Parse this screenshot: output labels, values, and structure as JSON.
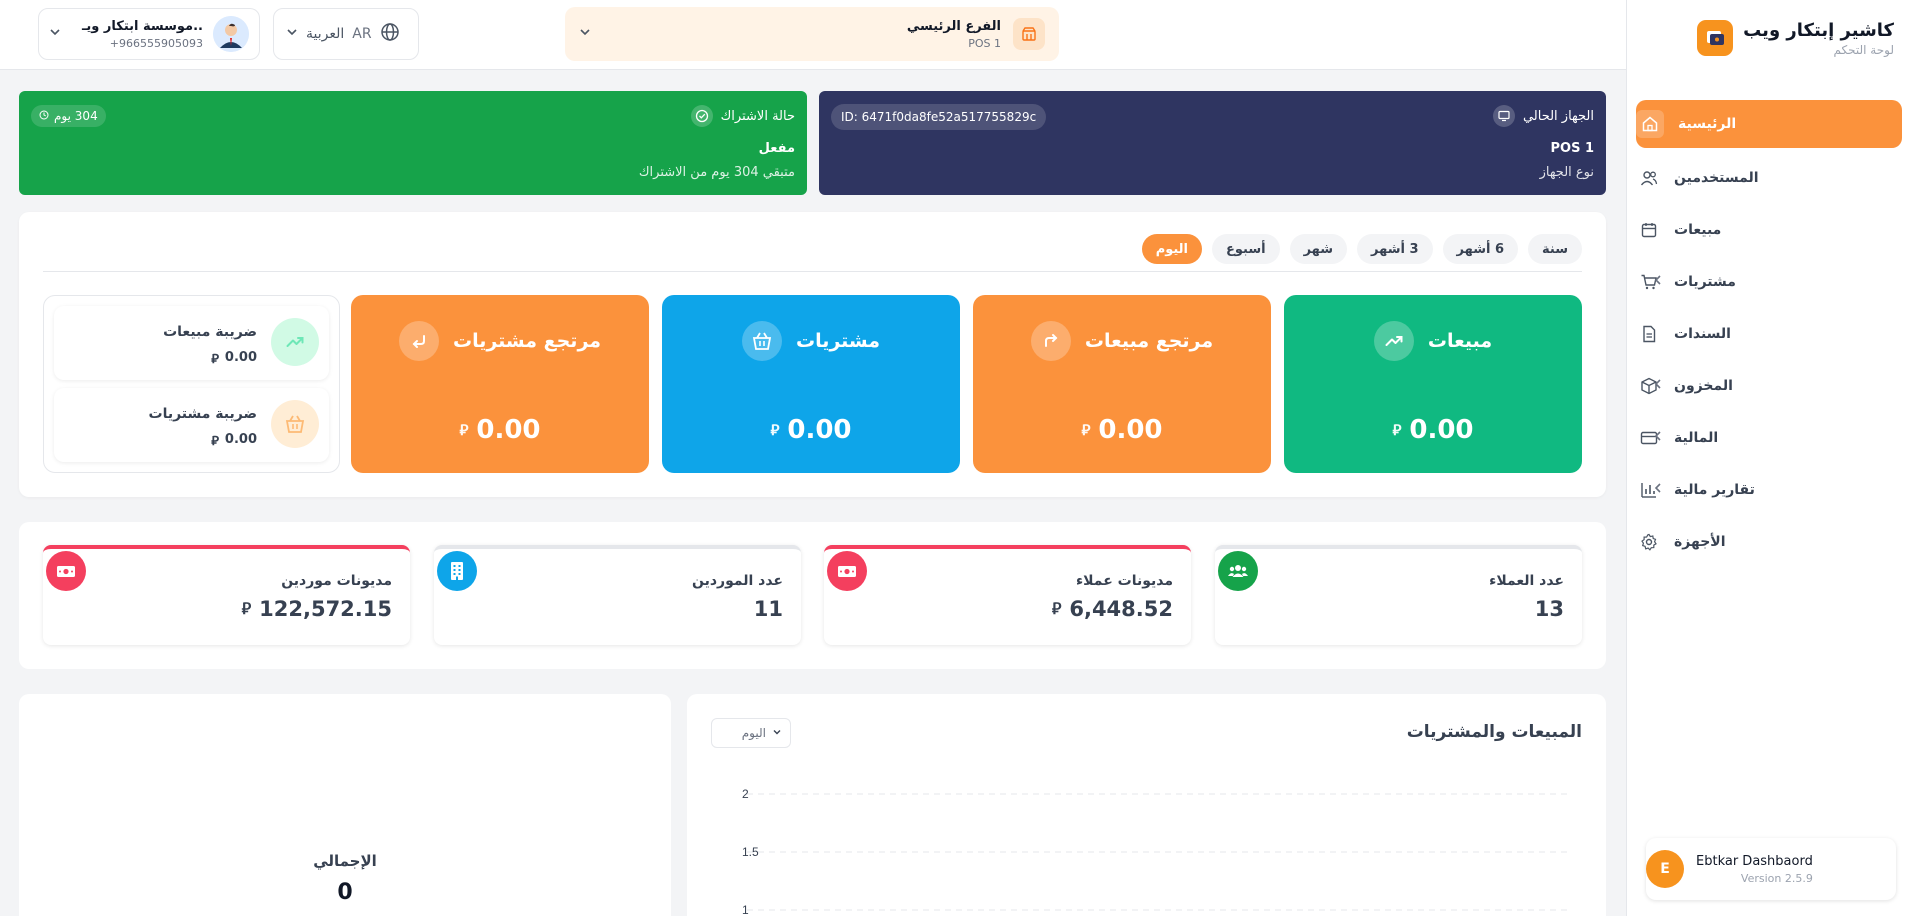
{
  "brand": {
    "title": "كاشير إبتكار ويب",
    "subtitle": "لوحة التحكم"
  },
  "sidebar": {
    "items": [
      {
        "label": "الرئيسية",
        "icon": "home-icon",
        "active": true,
        "expandable": false
      },
      {
        "label": "المستخدمين",
        "icon": "users-icon",
        "active": false,
        "expandable": false
      },
      {
        "label": "مبيعات",
        "icon": "calendar-icon",
        "active": false,
        "expandable": false
      },
      {
        "label": "مشتريات",
        "icon": "cart-icon",
        "active": false,
        "expandable": true
      },
      {
        "label": "السندات",
        "icon": "document-icon",
        "active": false,
        "expandable": false
      },
      {
        "label": "المخزون",
        "icon": "box-icon",
        "active": false,
        "expandable": true
      },
      {
        "label": "المالية",
        "icon": "card-icon",
        "active": false,
        "expandable": true
      },
      {
        "label": "تقارير مالية",
        "icon": "bar-chart-icon",
        "active": false,
        "expandable": true
      },
      {
        "label": "الأجهزة",
        "icon": "gear-icon",
        "active": false,
        "expandable": false
      }
    ],
    "version_card": {
      "avatar_letter": "E",
      "name": "Ebtkar Dashbaord",
      "version": "Version 2.5.9"
    }
  },
  "header": {
    "user": {
      "name": "موسسة ابتكار ويـ..",
      "phone": "+966555905093"
    },
    "language": {
      "label": "العربية",
      "code": "AR"
    },
    "branch": {
      "name": "الفرع الرئيسي",
      "pos": "POS 1"
    }
  },
  "device_card": {
    "title": "الجهاز الحالي",
    "device_id": "ID: 6471f0da8fe52a517755829c",
    "pos": "POS 1",
    "type_label": "نوع الجهاز",
    "color": "#2f3561"
  },
  "subscription_card": {
    "title": "حالة الاشتراك",
    "status": "مفعل",
    "remaining": "متبقي 304 يوم من الاشتراك",
    "days_pill": "304 يوم",
    "color": "#16a34a"
  },
  "periods": [
    "اليوم",
    "أسبوع",
    "شهر",
    "3 أشهر",
    "6 أشهر",
    "سنة"
  ],
  "active_period": "اليوم",
  "stat_cards": [
    {
      "label": "مبيعات",
      "value": "0.00",
      "color": "#10b981",
      "icon": "trend-up-icon"
    },
    {
      "label": "مرتجع مبيعات",
      "value": "0.00",
      "color": "#fb923c",
      "icon": "return-right-icon"
    },
    {
      "label": "مشتريات",
      "value": "0.00",
      "color": "#0ea5e9",
      "icon": "basket-icon"
    },
    {
      "label": "مرتجع مشتريات",
      "value": "0.00",
      "color": "#fb923c",
      "icon": "return-left-icon"
    }
  ],
  "taxes": [
    {
      "label": "ضريبة مبيعات",
      "value": "0.00",
      "icon": "trend-up-icon",
      "color": "#d1fae5"
    },
    {
      "label": "ضريبة مشتريات",
      "value": "0.00",
      "icon": "basket-icon",
      "color": "#ffedd5"
    }
  ],
  "currency_symbol": "⃁",
  "counts": [
    {
      "label": "عدد العملاء",
      "value": "13",
      "icon": "people-icon",
      "icon_color": "#16a34a",
      "accent": false,
      "currency": false
    },
    {
      "label": "مديونات عملاء",
      "value": "6,448.52",
      "icon": "money-icon",
      "icon_color": "#f43f5e",
      "accent": true,
      "currency": true
    },
    {
      "label": "عدد الموردين",
      "value": "11",
      "icon": "building-icon",
      "icon_color": "#0ea5e9",
      "accent": false,
      "currency": false
    },
    {
      "label": "مديونات موردين",
      "value": "122,572.15",
      "icon": "money-icon",
      "icon_color": "#f43f5e",
      "accent": true,
      "currency": true
    }
  ],
  "sales_chart": {
    "title": "المبيعات والمشتريات",
    "select_value": "اليوم"
  },
  "chart_data": {
    "type": "line",
    "title": "المبيعات والمشتريات",
    "y_ticks": [
      "2",
      "1.5",
      "1"
    ],
    "ylim": [
      1,
      2
    ],
    "series": []
  },
  "total": {
    "label": "الإجمالي",
    "value": "0"
  }
}
